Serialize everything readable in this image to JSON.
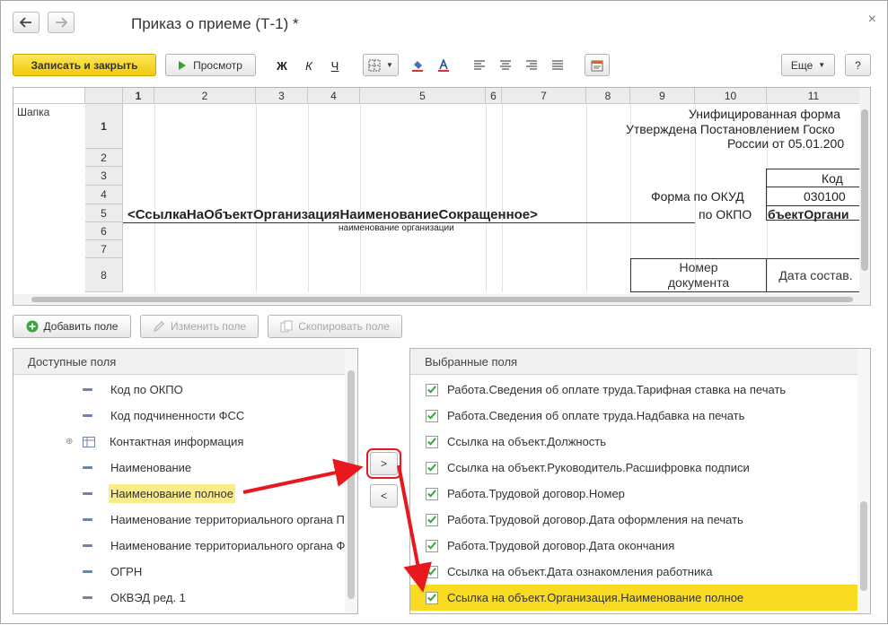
{
  "window": {
    "title": "Приказ о приеме (Т-1) *",
    "close": "×"
  },
  "toolbar": {
    "save_close": "Записать и закрыть",
    "preview": "Просмотр",
    "bold": "Ж",
    "italic": "К",
    "underline": "Ч",
    "more": "Еще",
    "help": "?"
  },
  "sheet": {
    "columns": [
      "1",
      "2",
      "3",
      "4",
      "5",
      "6",
      "7",
      "8",
      "9",
      "10",
      "11"
    ],
    "rows": [
      "1",
      "2",
      "3",
      "4",
      "5",
      "6",
      "7",
      "8"
    ],
    "section_label": "Шапка",
    "unified_form": "Унифицированная форма",
    "approved_by": "Утверждена Постановлением Госко",
    "russia_from": "России от 05.01.200",
    "code_header": "Код",
    "okud_label": "Форма по ОКУД",
    "okud_value": "030100",
    "okpo_label": "по ОКПО",
    "okpo_value": "бъектОргани",
    "org_ref": "<СсылкаНаОбъектОрганизацияНаименованиеСокращенное>",
    "org_caption": "наименование организации",
    "doc_number": "Номер документа",
    "date_compiled": "Дата состав."
  },
  "field_buttons": {
    "add": "Добавить поле",
    "edit": "Изменить поле",
    "copy": "Скопировать поле"
  },
  "available": {
    "header": "Доступные поля",
    "items": [
      "Код по ОКПО",
      "Код подчиненности ФСС",
      "Контактная информация",
      "Наименование",
      "Наименование полное",
      "Наименование территориального органа ПФ",
      "Наименование территориального органа ФС",
      "ОГРН",
      "ОКВЭД ред. 1"
    ]
  },
  "move": {
    "right": ">",
    "left": "<"
  },
  "selected": {
    "header": "Выбранные поля",
    "items": [
      "Работа.Сведения об оплате труда.Тарифная ставка на печать",
      "Работа.Сведения об оплате труда.Надбавка на печать",
      "Ссылка на объект.Должность",
      "Ссылка на объект.Руководитель.Расшифровка подписи",
      "Работа.Трудовой договор.Номер",
      "Работа.Трудовой договор.Дата оформления на печать",
      "Работа.Трудовой договор.Дата окончания",
      "Ссылка на объект.Дата ознакомления работника",
      "Ссылка на объект.Организация.Наименование полное"
    ]
  },
  "colors": {
    "primary": "#f5d018",
    "highlight_row": "#f9dc21",
    "highlight_item": "#fbec88",
    "arrow": "#e8181e",
    "check": "#3aa63a"
  }
}
